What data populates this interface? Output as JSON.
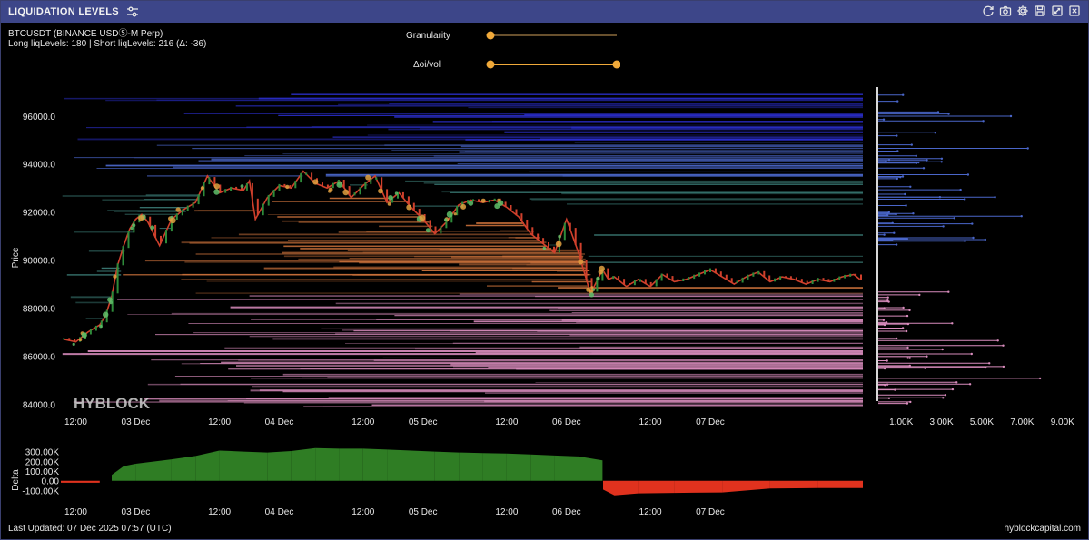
{
  "window": {
    "title": "LIQUIDATION LEVELS",
    "icons": [
      "settings-sliders-icon",
      "refresh-icon",
      "camera-icon",
      "gear-icon",
      "save-icon",
      "expand-icon",
      "close-icon"
    ]
  },
  "info": {
    "symbol": "BTCUSDT (BINANCE USDⓈ-M Perp)",
    "levels": "Long liqLevels: 180 | Short liqLevels: 216 (Δ: -36)"
  },
  "controls": {
    "granularity_label": "Granularity",
    "granularity_value": 0.0,
    "oi_vol_label": "Δoi/vol",
    "oi_vol_range": [
      0.0,
      1.0
    ],
    "accent": "#f0a93a"
  },
  "watermark": "HYBLOCK",
  "colors": {
    "background": "#000000",
    "titlebar": "#3d4689",
    "short_levels": "#2b2fd0",
    "short_levels_mid": "#4a66c9",
    "short_levels_teal": "#3a7a74",
    "long_levels_orange": "#c9703a",
    "long_levels_pink": "#d98cbd",
    "candle_up": "#2e8b3a",
    "candle_down": "#d0402c",
    "delta_positive": "#2f7d24",
    "delta_negative": "#e0321e"
  },
  "chart_data": [
    {
      "type": "line",
      "name": "price",
      "ylabel": "Price",
      "yticks": [
        "96000.0",
        "94000.0",
        "92000.0",
        "90000.0",
        "88000.0",
        "86000.0",
        "84000.0"
      ],
      "ylim": [
        83600,
        97200
      ],
      "xticks": [
        "12:00",
        "03 Dec",
        "12:00",
        "04 Dec",
        "12:00",
        "05 Dec",
        "12:00",
        "06 Dec",
        "12:00",
        "07 Dec"
      ],
      "xlim_hours": [
        -6.5,
        127.5
      ],
      "x_hours": [
        -6,
        -4,
        -2,
        0,
        1,
        2,
        3,
        4,
        5,
        6,
        7,
        8,
        10,
        12,
        14,
        16,
        18,
        20,
        22,
        24,
        25,
        26,
        28,
        30,
        32,
        34,
        36,
        38,
        40,
        42,
        44,
        46,
        48,
        50,
        52,
        54,
        56,
        58,
        60,
        62,
        64,
        66,
        68,
        70,
        72,
        74,
        76,
        78,
        80,
        82,
        84,
        85,
        86,
        87,
        88,
        90,
        92,
        94,
        96,
        98,
        100,
        102,
        104,
        106,
        108,
        110,
        112,
        114,
        116,
        118,
        120,
        122,
        124,
        126,
        127
      ],
      "price": [
        86700,
        86600,
        87000,
        87300,
        87700,
        88500,
        89800,
        90600,
        91300,
        91700,
        91900,
        91600,
        90600,
        91700,
        92100,
        92400,
        93500,
        92800,
        93000,
        92900,
        93300,
        91700,
        92600,
        93100,
        93000,
        93700,
        93200,
        93000,
        93300,
        92600,
        93100,
        93500,
        92400,
        92800,
        92200,
        91700,
        91100,
        91600,
        92300,
        92500,
        92400,
        92500,
        92200,
        91800,
        91100,
        90700,
        90300,
        91700,
        90300,
        88600,
        89600,
        89200,
        89300,
        89100,
        88900,
        89200,
        88900,
        89400,
        89100,
        89200,
        89400,
        89600,
        89300,
        89000,
        89300,
        89500,
        89100,
        89300,
        89200,
        89000,
        89200,
        89100,
        89300,
        89400,
        89200
      ]
    },
    {
      "type": "bar",
      "name": "liquidation-volume-profile",
      "xticks": [
        "1.00K",
        "3.00K",
        "5.00K",
        "7.00K",
        "9.00K"
      ],
      "xlim": [
        0,
        10000
      ]
    },
    {
      "type": "area",
      "name": "delta",
      "ylabel": "Delta",
      "yticks": [
        "300.00K",
        "200.00K",
        "100.00K",
        "0.00",
        "-100.00K"
      ],
      "ylim": [
        -180000,
        380000
      ],
      "xticks": [
        "12:00",
        "03 Dec",
        "12:00",
        "04 Dec",
        "12:00",
        "05 Dec",
        "12:00",
        "06 Dec",
        "12:00",
        "07 Dec"
      ],
      "x_hours": [
        -6.5,
        0,
        2,
        4,
        6,
        8,
        12,
        16,
        20,
        24,
        28,
        32,
        36,
        40,
        44,
        48,
        52,
        56,
        60,
        64,
        68,
        72,
        76,
        80,
        84,
        84.1,
        86,
        90,
        96,
        104,
        112,
        120,
        127.5
      ],
      "values": [
        -20000,
        -20000,
        60000,
        150000,
        175000,
        190000,
        220000,
        255000,
        310000,
        300000,
        290000,
        305000,
        335000,
        330000,
        330000,
        320000,
        310000,
        300000,
        290000,
        285000,
        280000,
        270000,
        260000,
        250000,
        210000,
        -90000,
        -150000,
        -130000,
        -125000,
        -120000,
        -80000,
        -75000,
        -75000
      ]
    }
  ],
  "footer": {
    "last_updated": "Last Updated: 07 Dec 2025 07:57 (UTC)",
    "brand": "hyblockcapital.com"
  }
}
